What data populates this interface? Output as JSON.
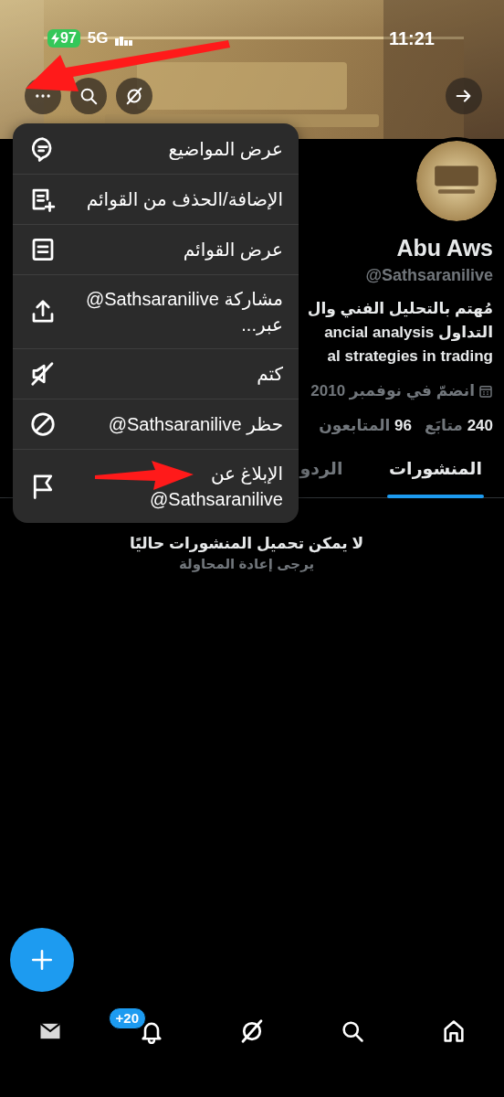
{
  "status_bar": {
    "battery": "97",
    "charging": true,
    "network": "5G",
    "time": "11:21"
  },
  "header_buttons": [
    {
      "kind": "more"
    },
    {
      "kind": "search"
    },
    {
      "kind": "grok"
    },
    {
      "kind": "forward"
    }
  ],
  "profile": {
    "name": "Abu Aws",
    "handle": "@Sathsaranilive",
    "bio_lines": [
      "مُهتم بالتحليل الفني وال",
      "التداول ancial analysis",
      "al strategies in trading"
    ],
    "joined": "انضمّ في نوفمبر 2010",
    "stats": [
      {
        "count": "240",
        "label": "متابَع"
      },
      {
        "count": "96",
        "label": "المتابعون"
      }
    ]
  },
  "tabs": [
    {
      "label": "المنشورات",
      "selected": true
    },
    {
      "label": "الردو",
      "selected": false
    }
  ],
  "empty_state": {
    "title": "لا يمكن تحميل المنشورات حاليًا",
    "subtitle": "يرجى إعادة المحاولة"
  },
  "menu": {
    "items": [
      {
        "kind": "topics",
        "label": "عرض المواضيع"
      },
      {
        "kind": "list-add",
        "label": "الإضافة/الحذف من القوائم"
      },
      {
        "kind": "lists",
        "label": "عرض القوائم"
      },
      {
        "kind": "share",
        "label": "مشاركة",
        "handle": "@Sathsaranilive",
        "suffix": "عبر..."
      },
      {
        "kind": "mute",
        "label": "كتم"
      },
      {
        "kind": "block",
        "label": "حظر",
        "handle": "@Sathsaranilive"
      },
      {
        "kind": "report",
        "label": "الإبلاغ عن",
        "handle": "@Sathsaranilive"
      }
    ]
  },
  "bottom_nav": [
    {
      "kind": "messages"
    },
    {
      "kind": "notifications",
      "badge": "+20"
    },
    {
      "kind": "grok"
    },
    {
      "kind": "search"
    },
    {
      "kind": "home"
    }
  ]
}
